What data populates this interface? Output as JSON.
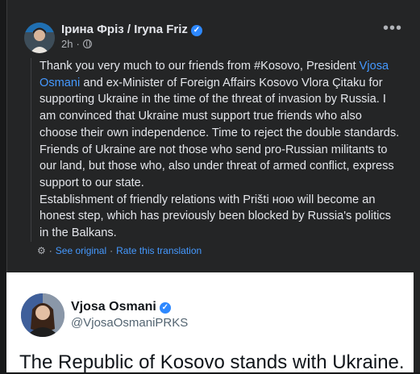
{
  "post": {
    "author": "Ірина Фріз / Iryna Friz",
    "time": "2h",
    "more_label": "•••",
    "body": {
      "part1": "Thank you very much to our friends from #Kosovo, President ",
      "mention": "Vjosa Osmani",
      "part2": " and ex-Minister of Foreign Affairs Kosovo Vlora Çitaku for supporting Ukraine in the time of the threat of invasion by Russia. I am convinced that Ukraine must support true friends who also choose their own independence. Time to reject the double standards. Friends of Ukraine are not those who send pro-Russian militants to our land, but those who, also under threat of armed conflict, express support to our state.",
      "paragraph2": "Establishment of friendly relations with Prištі ною will become an honest step, which has previously been blocked by Russia's politics in the Balkans."
    },
    "see_original": "See original",
    "separator": "·",
    "rate_translation": "Rate this translation"
  },
  "quote": {
    "name": "Vjosa Osmani",
    "handle": "@VjosaOsmaniPRKS",
    "text": "The Republic of Kosovo stands with Ukraine."
  },
  "colors": {
    "background": "#18191a",
    "card": "#242526",
    "link": "#4599ff",
    "verified": "#2d88ff"
  }
}
